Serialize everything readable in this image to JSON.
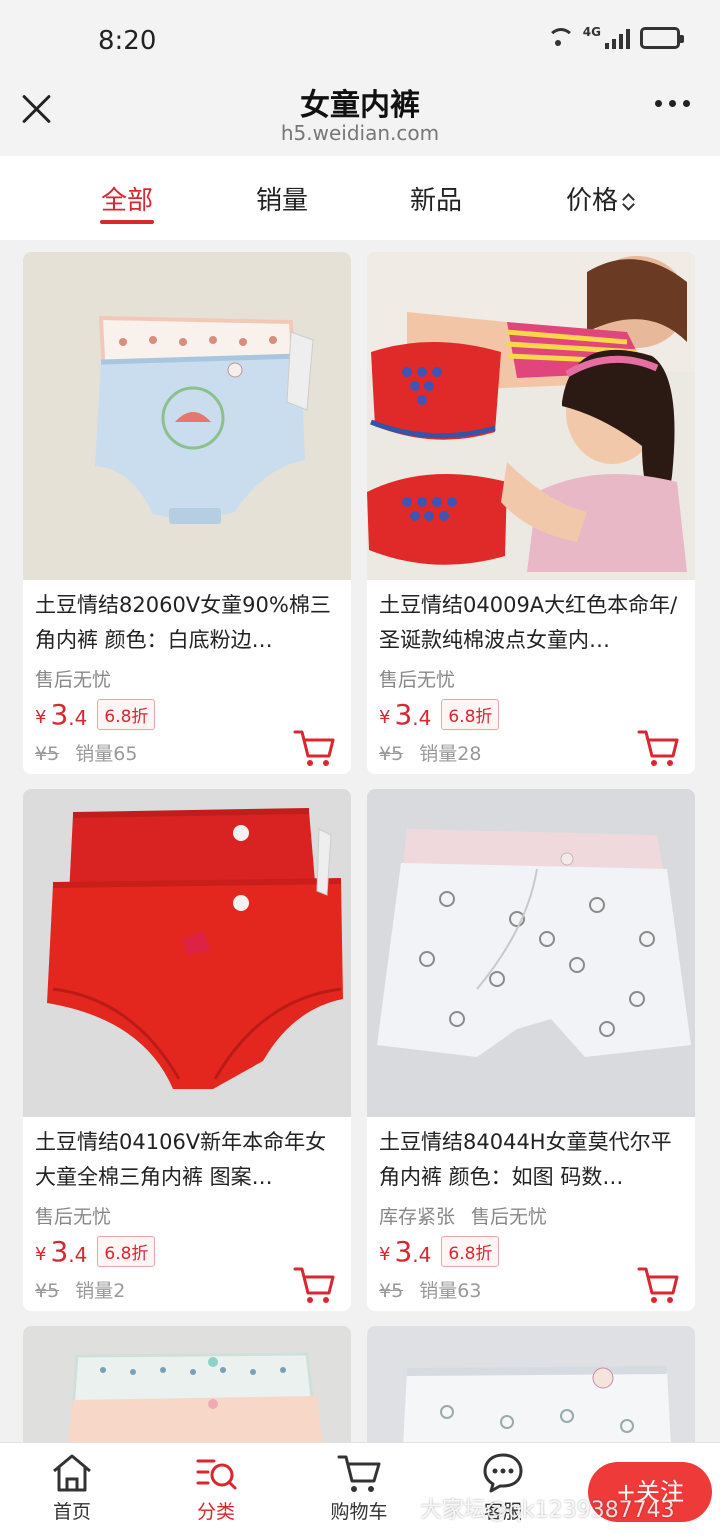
{
  "status_bar": {
    "time": "8:20",
    "network": "4G"
  },
  "header": {
    "title": "女童内裤",
    "url": "h5.weidian.com"
  },
  "tabs": [
    {
      "label": "全部",
      "active": true
    },
    {
      "label": "销量",
      "active": false
    },
    {
      "label": "新品",
      "active": false
    },
    {
      "label": "价格",
      "active": false
    }
  ],
  "products": [
    {
      "title": "土豆情结82060V女童90%棉三角内裤 颜色：白底粉边…",
      "tags": [
        "售后无忧"
      ],
      "yen": "¥",
      "price_int": "3",
      "price_dec": ".4",
      "discount": "6.8折",
      "original_price": "¥5",
      "sales": "销量65"
    },
    {
      "title": "土豆情结04009A大红色本命年/圣诞款纯棉波点女童内…",
      "tags": [
        "售后无忧"
      ],
      "yen": "¥",
      "price_int": "3",
      "price_dec": ".4",
      "discount": "6.8折",
      "original_price": "¥5",
      "sales": "销量28"
    },
    {
      "title": "土豆情结04106V新年本命年女大童全棉三角内裤 图案…",
      "tags": [
        "售后无忧"
      ],
      "yen": "¥",
      "price_int": "3",
      "price_dec": ".4",
      "discount": "6.8折",
      "original_price": "¥5",
      "sales": "销量2"
    },
    {
      "title": "土豆情结84044H女童莫代尔平角内裤 颜色：如图 码数…",
      "tags": [
        "库存紧张",
        "售后无忧"
      ],
      "yen": "¥",
      "price_int": "3",
      "price_dec": ".4",
      "discount": "6.8折",
      "original_price": "¥5",
      "sales": "销量63"
    }
  ],
  "bottom_nav": [
    {
      "label": "首页",
      "icon": "home-icon",
      "active": false
    },
    {
      "label": "分类",
      "icon": "category-search-icon",
      "active": true
    },
    {
      "label": "购物车",
      "icon": "cart-icon",
      "active": false
    },
    {
      "label": "客服",
      "icon": "chat-icon",
      "active": false
    }
  ],
  "follow_button": "+关注",
  "watermark": "大家坛@qk1239387743",
  "colors": {
    "accent": "#d8272f",
    "follow": "#ef3a3a"
  }
}
